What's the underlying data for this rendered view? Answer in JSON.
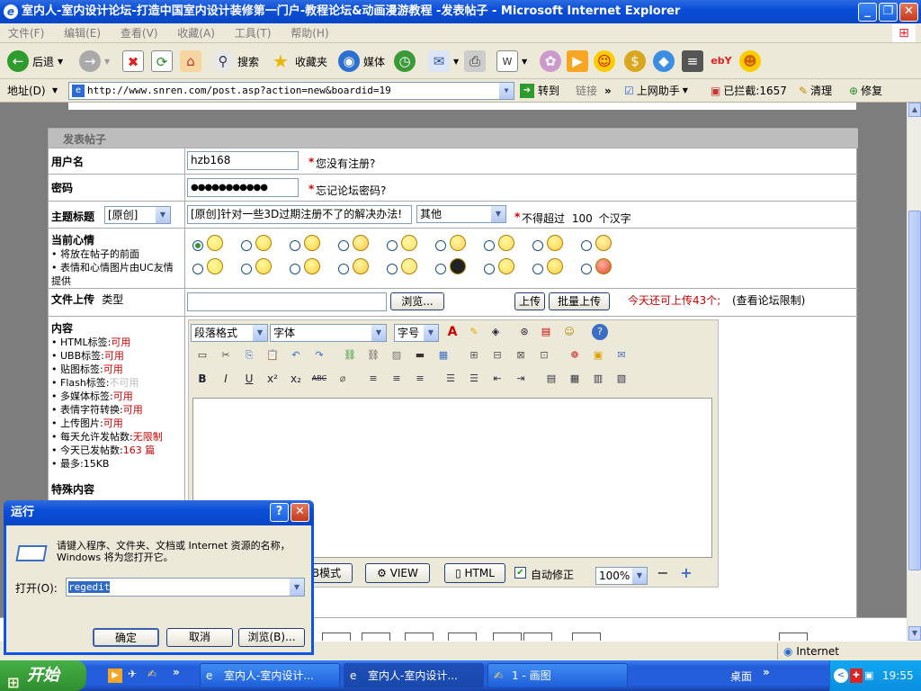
{
  "window": {
    "title": "室内人-室内设计论坛-打造中国室内设计装修第一门户-教程论坛&动画漫游教程 -发表帖子 - Microsoft Internet Explorer",
    "min": "_",
    "restore": "❐",
    "close": "✕"
  },
  "menu": [
    "文件(F)",
    "编辑(E)",
    "查看(V)",
    "收藏(A)",
    "工具(T)",
    "帮助(H)"
  ],
  "toolbar": {
    "back": "后退",
    "search": "搜索",
    "favorites": "收藏夹",
    "media": "媒体"
  },
  "address": {
    "label": "地址(D)",
    "url": "http://www.snren.com/post.asp?action=new&boardid=19",
    "go": "转到",
    "links": "链接",
    "helper": "上网助手",
    "blocked": "已拦截:1657",
    "clean": "清理",
    "repair": "修复"
  },
  "form": {
    "header": "发表帖子",
    "username_label": "用户名",
    "username_value": "hzb168",
    "not_registered": "您没有注册?",
    "password_label": "密码",
    "password_value": "●●●●●●●●●●●",
    "forgot_password": "忘记论坛密码?",
    "subject_label": "主题标题",
    "subject_type": "[原创]",
    "subject_value": "[原创]针对一些3D过期注册不了的解决办法!",
    "category": "其他",
    "subject_limit": "不得超过",
    "subject_limit_num": "100",
    "subject_limit_unit": "个汉字",
    "mood_label": "当前心情",
    "mood_note1": "将放在帖子的前面",
    "mood_note2": "表情和心情图片由UC友情提供",
    "upload_label": "文件上传",
    "upload_type": "类型",
    "browse": "浏览...",
    "upload": "上传",
    "batch_upload": "批量上传",
    "upload_remaining": "今天还可上传43个;",
    "forum_limit": "(查看论坛限制)",
    "content_label": "内容",
    "content_rules": [
      {
        "label": "HTML标签:",
        "value": "可用",
        "cls": "red"
      },
      {
        "label": "UBB标签:",
        "value": "可用",
        "cls": "red"
      },
      {
        "label": "贴图标签:",
        "value": "可用",
        "cls": "red"
      },
      {
        "label": "Flash标签:",
        "value": "不可用",
        "cls": "gray"
      },
      {
        "label": "多媒体标签:",
        "value": "可用",
        "cls": "red"
      },
      {
        "label": "表情字符转换:",
        "value": "可用",
        "cls": "red"
      },
      {
        "label": "上传图片:",
        "value": "可用",
        "cls": "red"
      },
      {
        "label": "每天允许发帖数:",
        "value": "无限制",
        "cls": "red"
      },
      {
        "label": "今天已发帖数:",
        "value": "163 篇",
        "cls": "mixed"
      },
      {
        "label": "最多:",
        "value": "15KB",
        "cls": "plain"
      }
    ],
    "special_content": "特殊内容"
  },
  "editor": {
    "para_format": "段落格式",
    "font": "字体",
    "font_size": "字号",
    "mode_design": "B模式",
    "mode_view": "VIEW",
    "mode_html": "HTML",
    "autocorrect": "自动修正",
    "zoom": "100%",
    "zoom_out": "−",
    "zoom_in": "+",
    "format_buttons": [
      "B",
      "I",
      "U",
      "x²",
      "x₂",
      "ABC"
    ]
  },
  "statusbar": {
    "zone": "Internet"
  },
  "taskbar": {
    "start": "开始",
    "tasks": [
      "室内人-室内设计...",
      "室内人-室内设计...",
      "1 - 画图"
    ],
    "desktop": "桌面",
    "clock": "19:55"
  },
  "run_dialog": {
    "title": "运行",
    "description": "请键入程序、文件夹、文档或 Internet 资源的名称，Windows 将为您打开它。",
    "open_label": "打开(O):",
    "open_value": "regedit",
    "ok": "确定",
    "cancel": "取消",
    "browse": "浏览(B)...",
    "help": "?",
    "close": "✕"
  }
}
